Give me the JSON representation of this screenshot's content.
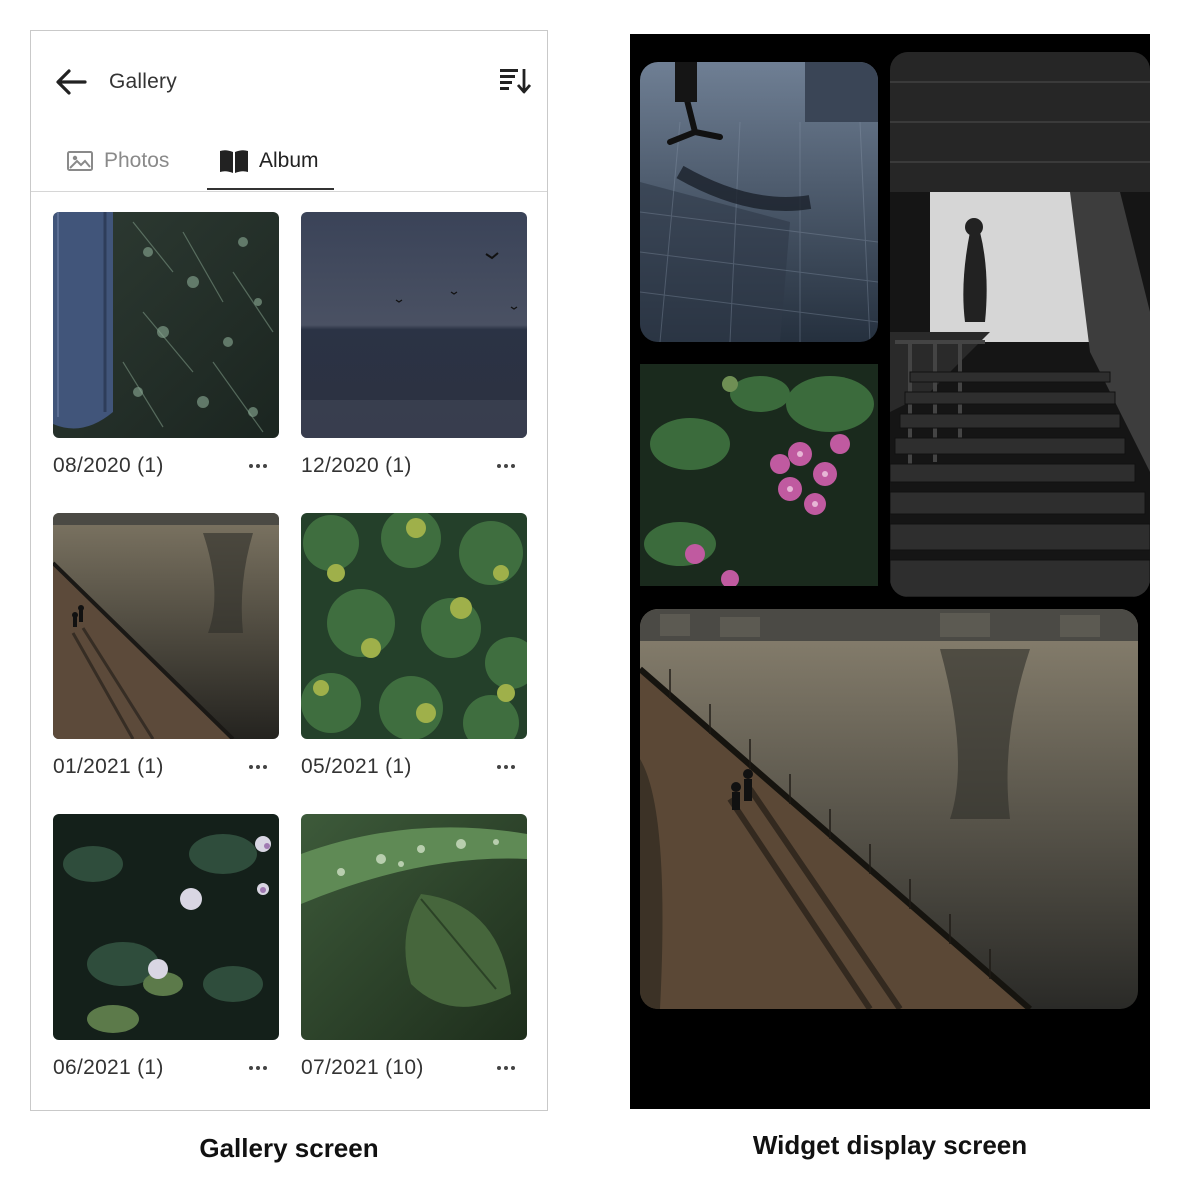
{
  "gallery": {
    "title": "Gallery",
    "tabs": [
      {
        "label": "Photos",
        "selected": false
      },
      {
        "label": "Album",
        "selected": true
      }
    ],
    "albums": [
      {
        "label": "08/2020 (1)",
        "thumb": "denim-and-plants"
      },
      {
        "label": "12/2020 (1)",
        "thumb": "dark-sea"
      },
      {
        "label": "01/2021 (1)",
        "thumb": "riverside-walk"
      },
      {
        "label": "05/2021 (1)",
        "thumb": "green-shrub"
      },
      {
        "label": "06/2021 (1)",
        "thumb": "hydrangea-leaves"
      },
      {
        "label": "07/2021 (10)",
        "thumb": "leaf-droplets"
      }
    ]
  },
  "widget": {
    "tiles": [
      {
        "name": "street-shadow"
      },
      {
        "name": "staircase"
      },
      {
        "name": "pink-flowers"
      },
      {
        "name": "riverside-walk"
      }
    ],
    "background_color": "#000000"
  },
  "captions": {
    "left": "Gallery screen",
    "right": "Widget display screen"
  },
  "colors": {
    "text": "#333333",
    "muted_tab": "#8a8a8a",
    "border": "#c9c9c9"
  }
}
